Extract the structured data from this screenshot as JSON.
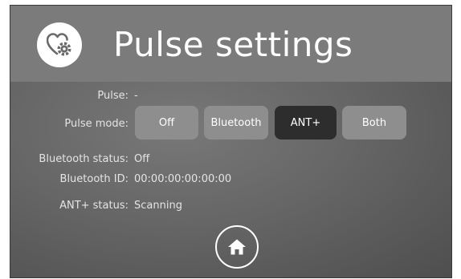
{
  "header": {
    "title": "Pulse settings",
    "icon": "heart-settings-icon"
  },
  "pulse": {
    "label": "Pulse:",
    "value": "-"
  },
  "pulse_mode": {
    "label": "Pulse mode:",
    "options": [
      "Off",
      "Bluetooth",
      "ANT+",
      "Both"
    ],
    "selected": "ANT+"
  },
  "bluetooth_status": {
    "label": "Bluetooth status:",
    "value": "Off"
  },
  "bluetooth_id": {
    "label": "Bluetooth ID:",
    "value": "00:00:00:00:00:00"
  },
  "ant_status": {
    "label": "ANT+ status:",
    "value": "Scanning"
  },
  "footer": {
    "home_icon": "home-icon"
  },
  "colors": {
    "header_bg": "#7b7b7b",
    "button_bg": "#8e8e8e",
    "button_active_bg": "#2d2d2d"
  }
}
